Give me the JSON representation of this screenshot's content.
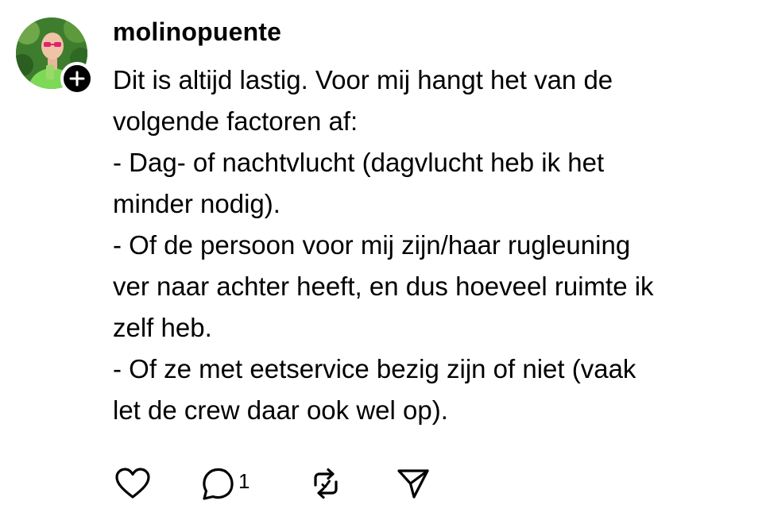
{
  "post": {
    "username": "molinopuente",
    "body_lines": [
      "Dit is altijd lastig. Voor mij hangt het van de",
      "volgende factoren af:",
      "- Dag- of nachtvlucht (dagvlucht heb ik het",
      "minder nodig).",
      "- Of de persoon voor mij zijn/haar rugleuning",
      "ver naar achter heeft, en dus hoeveel ruimte ik",
      "zelf heb.",
      "- Of ze met eetservice bezig zijn of niet (vaak",
      "let de crew daar ook wel op)."
    ],
    "actions": {
      "like_icon": "heart-icon",
      "comment_icon": "comment-icon",
      "comment_count": "1",
      "repost_icon": "repost-icon",
      "share_icon": "send-icon"
    },
    "follow_icon": "plus-icon"
  },
  "colors": {
    "text": "#000000",
    "background": "#ffffff",
    "badge": "#000000"
  }
}
